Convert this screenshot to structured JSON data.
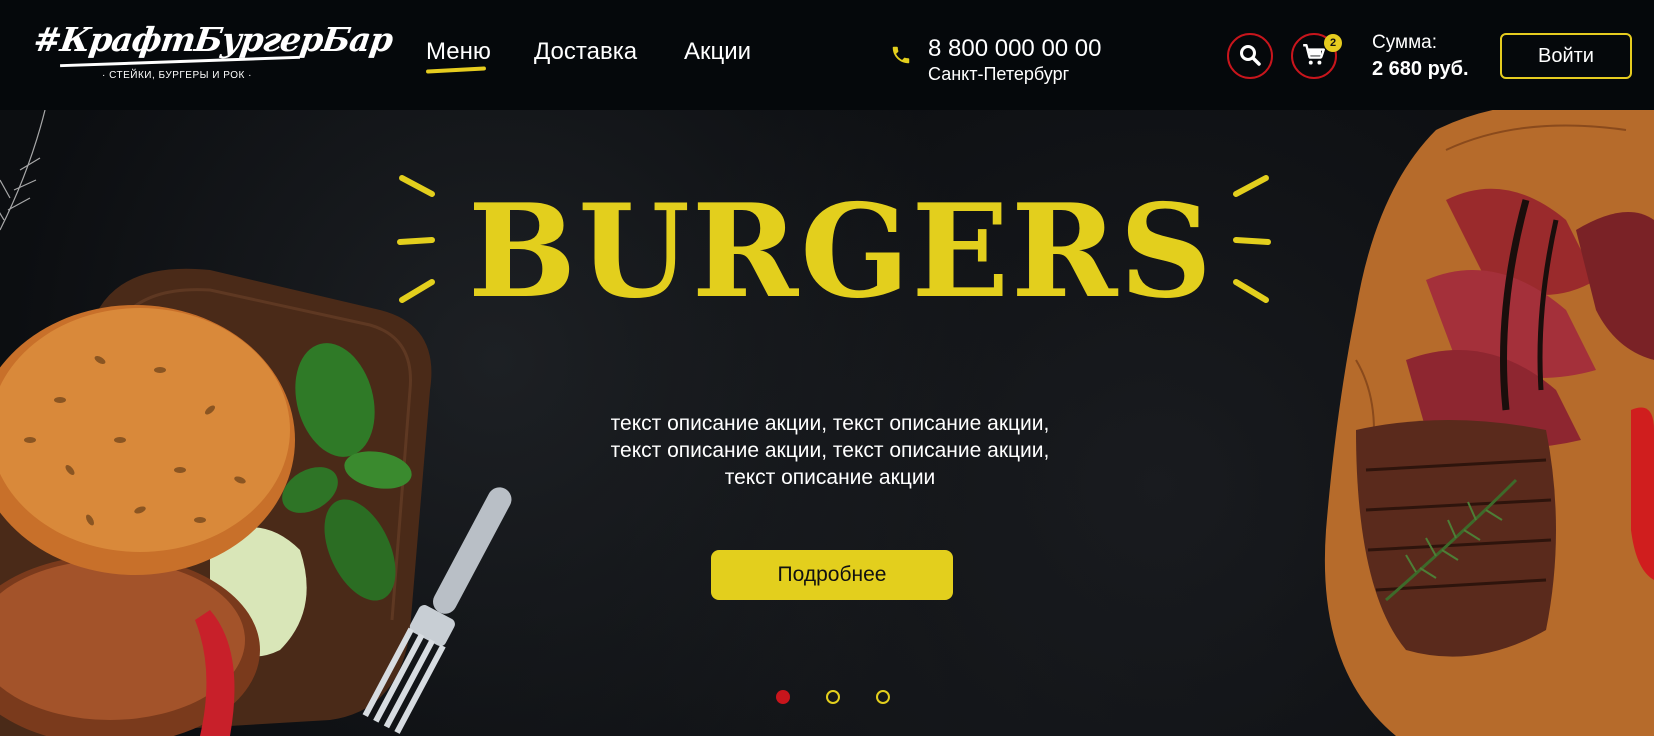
{
  "brand": {
    "logo_text": "#КрафтБургерБар",
    "tagline": "· СТЕЙКИ, БУРГЕРЫ И РОК ·"
  },
  "nav": {
    "items": [
      {
        "label": "Меню",
        "active": true
      },
      {
        "label": "Доставка",
        "active": false
      },
      {
        "label": "Акции",
        "active": false
      }
    ]
  },
  "contact": {
    "phone": "8 800 000 00 00",
    "city": "Санкт-Петербург"
  },
  "cart": {
    "count": "2",
    "sum_label": "Сумма:",
    "sum_value": "2 680 руб."
  },
  "auth": {
    "login_label": "Войти"
  },
  "hero": {
    "title": "BURGERS",
    "description_lines": [
      "текст описание акции, текст описание акции,",
      "текст описание акции, текст описание акции,",
      "текст описание акции"
    ],
    "button_label": "Подробнее",
    "slides": [
      {
        "active": true
      },
      {
        "active": false
      },
      {
        "active": false
      }
    ]
  },
  "colors": {
    "accent_yellow": "#e3cf1d",
    "accent_red": "#c8151c",
    "header_bg": "#05080b",
    "hero_bg": "#0c0e11"
  },
  "icons": {
    "phone": "phone-icon",
    "search": "search-icon",
    "cart": "cart-icon"
  }
}
